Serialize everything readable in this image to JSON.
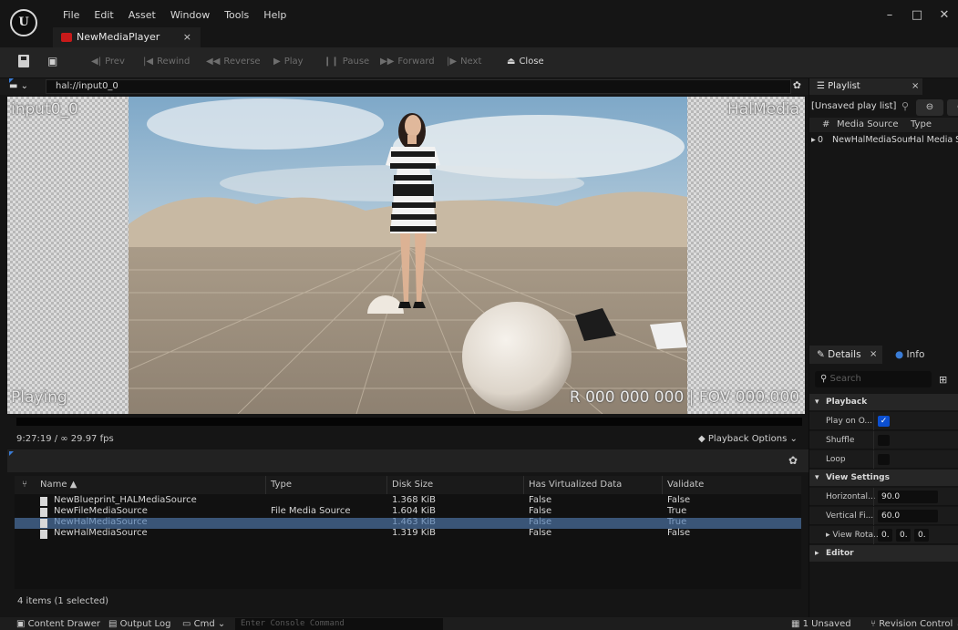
{
  "menu": [
    "File",
    "Edit",
    "Asset",
    "Window",
    "Tools",
    "Help"
  ],
  "document_tab": {
    "label": "NewMediaPlayer",
    "close": "×"
  },
  "window_controls": [
    "–",
    "□",
    "✕"
  ],
  "toolbar": {
    "prev": "Prev",
    "rewind": "Rewind",
    "reverse": "Reverse",
    "play": "Play",
    "pause": "Pause",
    "forward": "Forward",
    "next": "Next",
    "close": "Close"
  },
  "url": "hal://input0_0",
  "viewport": {
    "top_left": "input0_0",
    "top_right": "HalMedia",
    "bottom_left": "Playing",
    "bottom_right": "R 000 000 000 | FOV 000.000"
  },
  "playback": {
    "time": "9:27:19 / ∞ 29.97 fps",
    "options": "Playback Options"
  },
  "content_browser": {
    "columns": [
      "Name",
      "Type",
      "Disk Size",
      "Has Virtualized Data",
      "Validate"
    ],
    "rows": [
      {
        "name": "NewBlueprint_HALMediaSource",
        "type": "",
        "size": "1.368 KiB",
        "virt": "False",
        "validate": "False"
      },
      {
        "name": "NewFileMediaSource",
        "type": "File Media Source",
        "size": "1.604 KiB",
        "virt": "False",
        "validate": "True"
      },
      {
        "name": "NewHalMediaSource",
        "type": "",
        "size": "1.463 KiB",
        "virt": "False",
        "validate": "True"
      },
      {
        "name": "NewHalMediaSource",
        "type": "",
        "size": "1.319 KiB",
        "virt": "False",
        "validate": "False"
      }
    ],
    "selected_row": 2,
    "status": "4 items (1 selected)"
  },
  "bottom_bar": {
    "content_drawer": "Content Drawer",
    "output_log": "Output Log",
    "cmd": "Cmd",
    "console_placeholder": "Enter Console Command",
    "unsaved": "1 Unsaved",
    "revision_control": "Revision Control"
  },
  "playlist": {
    "tab": "Playlist",
    "name": "[Unsaved play list]",
    "columns": [
      "#",
      "Media Source",
      "Type"
    ],
    "rows": [
      {
        "index": "0",
        "source": "NewHalMediaSour",
        "type": "Hal Media So"
      }
    ]
  },
  "details": {
    "tab": "Details",
    "info_tab": "Info",
    "search_placeholder": "Search",
    "sections": {
      "playback": "Playback",
      "view_settings": "View Settings",
      "editor": "Editor"
    },
    "props": {
      "play_on_open": "Play on O...",
      "play_on_open_checked": true,
      "shuffle": "Shuffle",
      "shuffle_checked": false,
      "loop": "Loop",
      "loop_checked": false,
      "horizontal": "Horizontal...",
      "horizontal_value": "90.0",
      "vertical": "Vertical Fi...",
      "vertical_value": "60.0",
      "view_rotation": "View Rota...",
      "view_rotation_values": [
        "0.",
        "0.",
        "0."
      ]
    }
  },
  "colors": {
    "accent": "#3a7cd6",
    "selected_row": "#3a5577",
    "check": "#0b4fd1",
    "media_icon": "#c81a1a"
  }
}
